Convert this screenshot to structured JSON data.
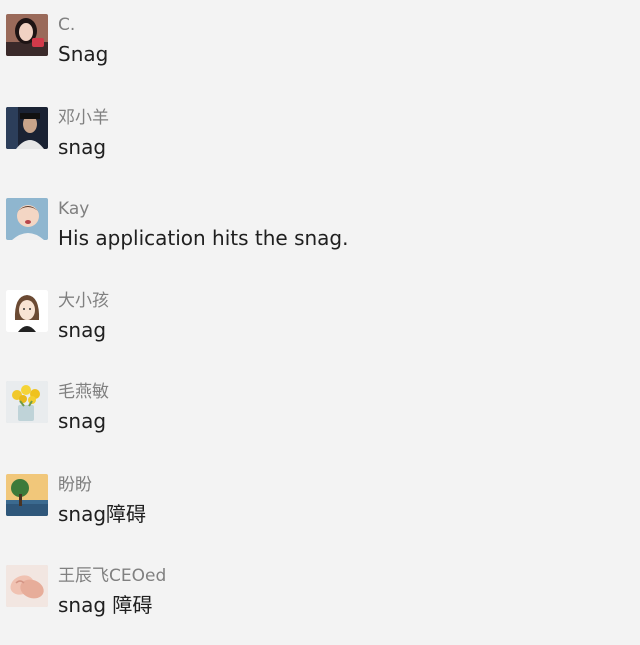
{
  "comments": [
    {
      "author": "C.",
      "text": "Snag",
      "avatar_icon": "woman-portrait-avatar"
    },
    {
      "author": "邓小羊",
      "text": "snag",
      "avatar_icon": "dark-portrait-avatar"
    },
    {
      "author": "Kay",
      "text": "His application hits the snag.",
      "avatar_icon": "baby-photo-avatar"
    },
    {
      "author": "大小孩",
      "text": "snag",
      "avatar_icon": "cartoon-girl-avatar"
    },
    {
      "author": "毛燕敏",
      "text": "snag",
      "avatar_icon": "yellow-flowers-avatar"
    },
    {
      "author": "盼盼",
      "text": "snag障碍",
      "avatar_icon": "tree-landscape-avatar"
    },
    {
      "author": "王辰飞CEOed",
      "text": "snag 障碍",
      "avatar_icon": "hands-photo-avatar"
    }
  ],
  "colors": {
    "background": "#f3f3f3",
    "author": "#808080",
    "text": "#202020"
  }
}
